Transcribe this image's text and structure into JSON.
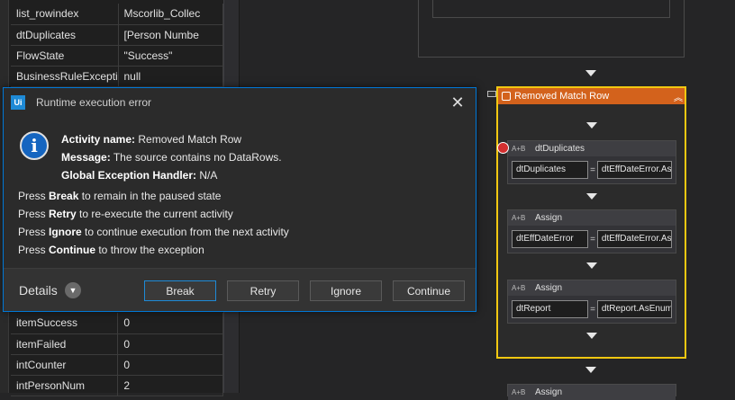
{
  "variables_top": [
    {
      "name": "list_rowindex",
      "value": "Mscorlib_Collec"
    },
    {
      "name": "dtDuplicates",
      "value": "[Person Numbe"
    },
    {
      "name": "FlowState",
      "value": "\"Success\""
    },
    {
      "name": "BusinessRuleExceptio",
      "value": "null"
    }
  ],
  "variables_bottom": [
    {
      "name": "itemSuccess",
      "value": "0"
    },
    {
      "name": "itemFailed",
      "value": "0"
    },
    {
      "name": "intCounter",
      "value": "0"
    },
    {
      "name": "intPersonNum",
      "value": "2"
    }
  ],
  "dialog": {
    "logo": "Ui",
    "title": "Runtime execution error",
    "close": "✕",
    "info_icon": "i",
    "activity_name_label": "Activity name:",
    "activity_name": "Removed Match Row",
    "message_label": "Message:",
    "message": "The source contains no DataRows.",
    "handler_label": "Global Exception Handler:",
    "handler": "N/A",
    "press": [
      {
        "prefix": "Press ",
        "key": "Break",
        "suffix": " to remain in the paused state"
      },
      {
        "prefix": "Press ",
        "key": "Retry",
        "suffix": " to re-execute the current activity"
      },
      {
        "prefix": "Press ",
        "key": "Ignore",
        "suffix": " to continue execution from the next activity"
      },
      {
        "prefix": "Press ",
        "key": "Continue",
        "suffix": " to throw the exception"
      }
    ],
    "details_label": "Details",
    "buttons": {
      "break": "Break",
      "retry": "Retry",
      "ignore": "Ignore",
      "continue": "Continue"
    }
  },
  "sequence": {
    "title": "Removed Match Row",
    "activities": [
      {
        "title": "dtDuplicates",
        "icon": "A+B",
        "to": "dtDuplicates",
        "value": "dtEffDateError.AsE"
      },
      {
        "title": "Assign",
        "icon": "A+B",
        "to": "dtEffDateError",
        "value": "dtEffDateError.AsE"
      },
      {
        "title": "Assign",
        "icon": "A+B",
        "to": "dtReport",
        "value": "dtReport.AsEnume"
      }
    ],
    "next_activity_title": "Assign"
  },
  "colors": {
    "accent": "#0078d7",
    "sequence_border": "#f2c811",
    "sequence_header": "#d3621c",
    "error_badge": "#d32f2f"
  }
}
